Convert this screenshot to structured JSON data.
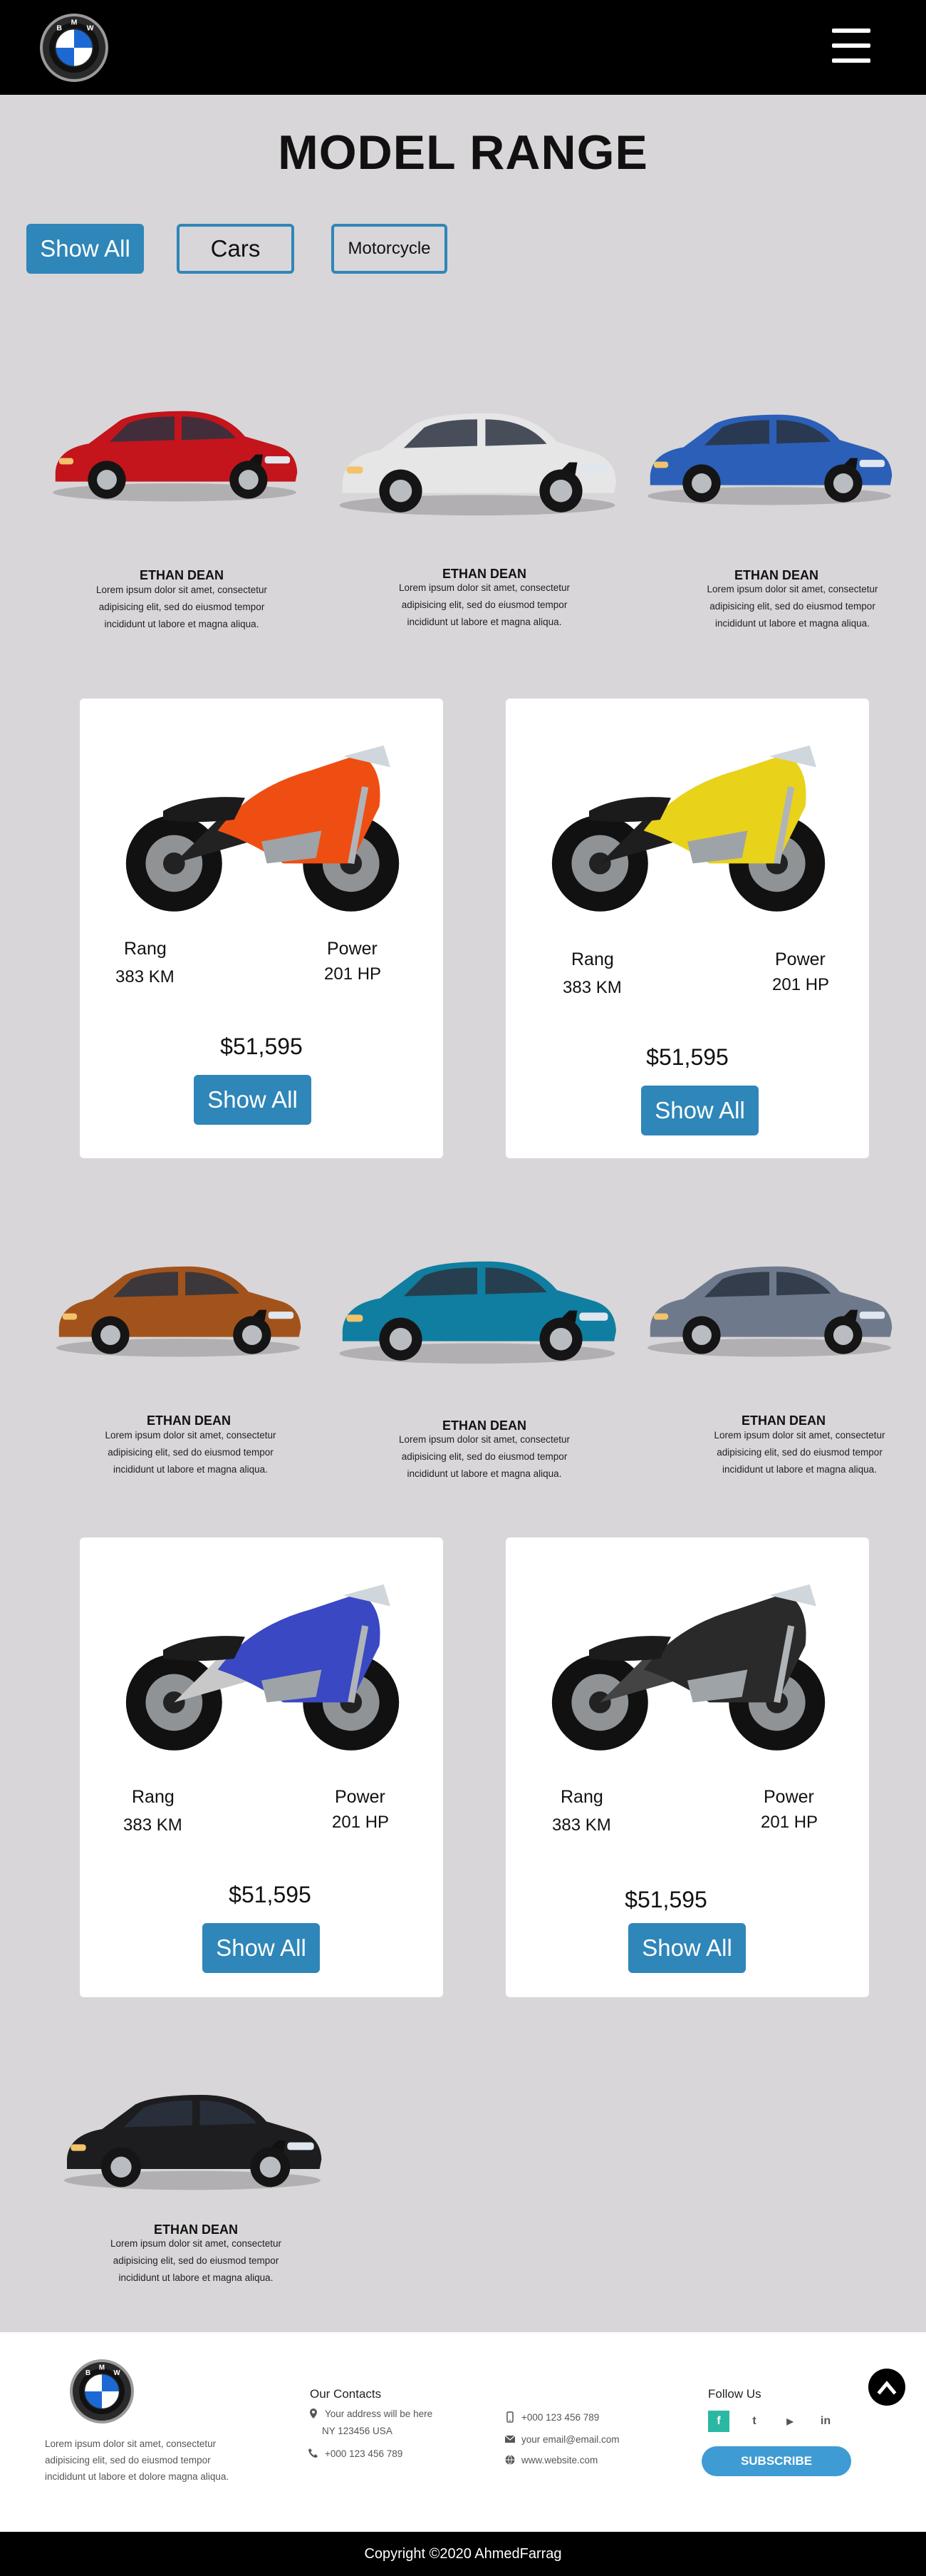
{
  "brand": {
    "logo_letters": [
      "B",
      "M",
      "W"
    ]
  },
  "page_title": "MODEL RANGE",
  "filters": [
    {
      "label": "Show All",
      "active": true
    },
    {
      "label": "Cars",
      "active": false
    },
    {
      "label": "Motorcycle",
      "active": false
    }
  ],
  "cars": [
    {
      "name": "ETHAN DEAN",
      "desc": "Lorem ipsum dolor sit amet, consectetur adipisicing elit, sed do eiusmod tempor incididunt ut labore et magna aliqua.",
      "color": "#c4141c"
    },
    {
      "name": "ETHAN DEAN",
      "desc": "Lorem ipsum dolor sit amet, consectetur adipisicing elit, sed do eiusmod tempor incididunt ut labore et magna aliqua.",
      "color": "#e6e6e6"
    },
    {
      "name": "ETHAN DEAN",
      "desc": "Lorem ipsum dolor sit amet, consectetur adipisicing elit, sed do eiusmod tempor incididunt ut labore et magna aliqua.",
      "color": "#2b5fb8"
    },
    {
      "name": "ETHAN DEAN",
      "desc": "Lorem ipsum dolor sit amet, consectetur adipisicing elit, sed do eiusmod tempor incididunt ut labore et magna aliqua.",
      "color": "#a2531c"
    },
    {
      "name": "ETHAN DEAN",
      "desc": "Lorem ipsum dolor sit amet, consectetur adipisicing elit, sed do eiusmod tempor incididunt ut labore et magna aliqua.",
      "color": "#0f7ea0"
    },
    {
      "name": "ETHAN DEAN",
      "desc": "Lorem ipsum dolor sit amet, consectetur adipisicing elit, sed do eiusmod tempor incididunt ut labore et magna aliqua.",
      "color": "#6e7a8c"
    },
    {
      "name": "ETHAN DEAN",
      "desc": "Lorem ipsum dolor sit amet, consectetur adipisicing elit, sed do eiusmod tempor incididunt ut labore et magna aliqua.",
      "color": "#1d1d20"
    }
  ],
  "bikes": [
    {
      "range_label": "Rang",
      "range_value": "383 KM",
      "power_label": "Power",
      "power_value": "201 HP",
      "price": "$51,595",
      "button": "Show All",
      "color": "#ef4e13",
      "accent": "#222"
    },
    {
      "range_label": "Rang",
      "range_value": "383 KM",
      "power_label": "Power",
      "power_value": "201 HP",
      "price": "$51,595",
      "button": "Show All",
      "color": "#e8d21a",
      "accent": "#1e1e1e"
    },
    {
      "range_label": "Rang",
      "range_value": "383 KM",
      "power_label": "Power",
      "power_value": "201 HP",
      "price": "$51,595",
      "button": "Show All",
      "color": "#3a48c4",
      "accent": "#c8c8c8"
    },
    {
      "range_label": "Rang",
      "range_value": "383 KM",
      "power_label": "Power",
      "power_value": "201 HP",
      "price": "$51,595",
      "button": "Show All",
      "color": "#2a2a2a",
      "accent": "#444"
    }
  ],
  "footer": {
    "about": "Lorem ipsum dolor sit amet, consectetur adipisicing elit, sed do eiusmod tempor incididunt ut labore et dolore magna aliqua.",
    "contacts_heading": "Our Contacts",
    "address_line1": "Your address will be here",
    "address_line2": "NY 123456 USA",
    "phone_left": "+000 123 456 789",
    "mobile": "+000 123 456 789",
    "email": "your email@email.com",
    "website": "www.website.com",
    "follow_heading": "Follow Us",
    "social": [
      {
        "name": "facebook",
        "glyph": "f"
      },
      {
        "name": "twitter",
        "glyph": "t"
      },
      {
        "name": "youtube",
        "glyph": "▶"
      },
      {
        "name": "linkedin",
        "glyph": "in"
      }
    ],
    "subscribe": "SUBSCRIBE",
    "copyright": "Copyright ©2020 AhmedFarrag"
  },
  "colors": {
    "accent": "#2f86b8",
    "subscribe": "#3f9bd3",
    "facebook": "#2bb8a3",
    "background": "#d8d6d8"
  }
}
